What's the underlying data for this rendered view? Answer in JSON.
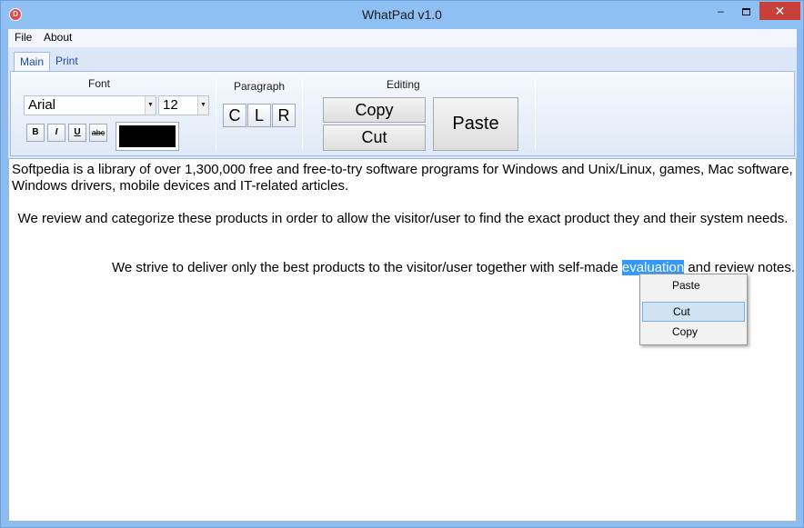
{
  "window": {
    "title": "WhatPad v1.0",
    "app_icon_glyph": "D",
    "controls": {
      "minimize": "–",
      "close": "✕"
    }
  },
  "menu": {
    "items": [
      "File",
      "About"
    ]
  },
  "tabs": [
    {
      "label": "Main",
      "active": true
    },
    {
      "label": "Print",
      "active": false
    }
  ],
  "ribbon": {
    "font_group": {
      "label": "Font",
      "font_family": "Arial",
      "font_size": "12",
      "bold": "B",
      "italic": "I",
      "underline": "U",
      "strikethrough": "abc",
      "color": "#000000"
    },
    "paragraph_group": {
      "label": "Paragraph",
      "center": "C",
      "left": "L",
      "right": "R"
    },
    "editing_group": {
      "label": "Editing",
      "copy": "Copy",
      "cut": "Cut",
      "paste": "Paste"
    }
  },
  "editor": {
    "paragraph1": "Softpedia is a library of over 1,300,000 free and free-to-try software programs for Windows and Unix/Linux, games, Mac software, Windows drivers, mobile devices and IT-related articles.",
    "paragraph2": "We review and categorize these products in order to allow the visitor/user to find the exact product they and their system needs.",
    "paragraph3_before": "We strive to deliver only the best products to the visitor/user together with self-made ",
    "paragraph3_selected": "evaluation",
    "paragraph3_after": " and review notes."
  },
  "context_menu": {
    "items": [
      "Paste",
      "Cut",
      "Copy"
    ],
    "highlighted": "Cut"
  },
  "colors": {
    "selection": "#3399ff",
    "close_button": "#c7413a",
    "title_bar": "#8fc0f3"
  }
}
